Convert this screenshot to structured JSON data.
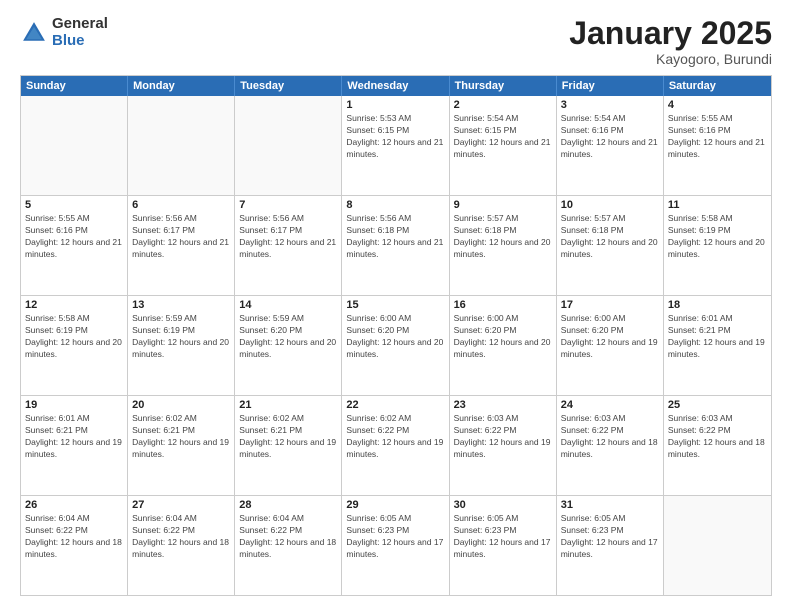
{
  "logo": {
    "general": "General",
    "blue": "Blue"
  },
  "header": {
    "month": "January 2025",
    "location": "Kayogoro, Burundi"
  },
  "weekdays": [
    "Sunday",
    "Monday",
    "Tuesday",
    "Wednesday",
    "Thursday",
    "Friday",
    "Saturday"
  ],
  "rows": [
    [
      {
        "day": "",
        "empty": true
      },
      {
        "day": "",
        "empty": true
      },
      {
        "day": "",
        "empty": true
      },
      {
        "day": "1",
        "sunrise": "5:53 AM",
        "sunset": "6:15 PM",
        "daylight": "12 hours and 21 minutes."
      },
      {
        "day": "2",
        "sunrise": "5:54 AM",
        "sunset": "6:15 PM",
        "daylight": "12 hours and 21 minutes."
      },
      {
        "day": "3",
        "sunrise": "5:54 AM",
        "sunset": "6:16 PM",
        "daylight": "12 hours and 21 minutes."
      },
      {
        "day": "4",
        "sunrise": "5:55 AM",
        "sunset": "6:16 PM",
        "daylight": "12 hours and 21 minutes."
      }
    ],
    [
      {
        "day": "5",
        "sunrise": "5:55 AM",
        "sunset": "6:16 PM",
        "daylight": "12 hours and 21 minutes."
      },
      {
        "day": "6",
        "sunrise": "5:56 AM",
        "sunset": "6:17 PM",
        "daylight": "12 hours and 21 minutes."
      },
      {
        "day": "7",
        "sunrise": "5:56 AM",
        "sunset": "6:17 PM",
        "daylight": "12 hours and 21 minutes."
      },
      {
        "day": "8",
        "sunrise": "5:56 AM",
        "sunset": "6:18 PM",
        "daylight": "12 hours and 21 minutes."
      },
      {
        "day": "9",
        "sunrise": "5:57 AM",
        "sunset": "6:18 PM",
        "daylight": "12 hours and 20 minutes."
      },
      {
        "day": "10",
        "sunrise": "5:57 AM",
        "sunset": "6:18 PM",
        "daylight": "12 hours and 20 minutes."
      },
      {
        "day": "11",
        "sunrise": "5:58 AM",
        "sunset": "6:19 PM",
        "daylight": "12 hours and 20 minutes."
      }
    ],
    [
      {
        "day": "12",
        "sunrise": "5:58 AM",
        "sunset": "6:19 PM",
        "daylight": "12 hours and 20 minutes."
      },
      {
        "day": "13",
        "sunrise": "5:59 AM",
        "sunset": "6:19 PM",
        "daylight": "12 hours and 20 minutes."
      },
      {
        "day": "14",
        "sunrise": "5:59 AM",
        "sunset": "6:20 PM",
        "daylight": "12 hours and 20 minutes."
      },
      {
        "day": "15",
        "sunrise": "6:00 AM",
        "sunset": "6:20 PM",
        "daylight": "12 hours and 20 minutes."
      },
      {
        "day": "16",
        "sunrise": "6:00 AM",
        "sunset": "6:20 PM",
        "daylight": "12 hours and 20 minutes."
      },
      {
        "day": "17",
        "sunrise": "6:00 AM",
        "sunset": "6:20 PM",
        "daylight": "12 hours and 19 minutes."
      },
      {
        "day": "18",
        "sunrise": "6:01 AM",
        "sunset": "6:21 PM",
        "daylight": "12 hours and 19 minutes."
      }
    ],
    [
      {
        "day": "19",
        "sunrise": "6:01 AM",
        "sunset": "6:21 PM",
        "daylight": "12 hours and 19 minutes."
      },
      {
        "day": "20",
        "sunrise": "6:02 AM",
        "sunset": "6:21 PM",
        "daylight": "12 hours and 19 minutes."
      },
      {
        "day": "21",
        "sunrise": "6:02 AM",
        "sunset": "6:21 PM",
        "daylight": "12 hours and 19 minutes."
      },
      {
        "day": "22",
        "sunrise": "6:02 AM",
        "sunset": "6:22 PM",
        "daylight": "12 hours and 19 minutes."
      },
      {
        "day": "23",
        "sunrise": "6:03 AM",
        "sunset": "6:22 PM",
        "daylight": "12 hours and 19 minutes."
      },
      {
        "day": "24",
        "sunrise": "6:03 AM",
        "sunset": "6:22 PM",
        "daylight": "12 hours and 18 minutes."
      },
      {
        "day": "25",
        "sunrise": "6:03 AM",
        "sunset": "6:22 PM",
        "daylight": "12 hours and 18 minutes."
      }
    ],
    [
      {
        "day": "26",
        "sunrise": "6:04 AM",
        "sunset": "6:22 PM",
        "daylight": "12 hours and 18 minutes."
      },
      {
        "day": "27",
        "sunrise": "6:04 AM",
        "sunset": "6:22 PM",
        "daylight": "12 hours and 18 minutes."
      },
      {
        "day": "28",
        "sunrise": "6:04 AM",
        "sunset": "6:22 PM",
        "daylight": "12 hours and 18 minutes."
      },
      {
        "day": "29",
        "sunrise": "6:05 AM",
        "sunset": "6:23 PM",
        "daylight": "12 hours and 17 minutes."
      },
      {
        "day": "30",
        "sunrise": "6:05 AM",
        "sunset": "6:23 PM",
        "daylight": "12 hours and 17 minutes."
      },
      {
        "day": "31",
        "sunrise": "6:05 AM",
        "sunset": "6:23 PM",
        "daylight": "12 hours and 17 minutes."
      },
      {
        "day": "",
        "empty": true
      }
    ]
  ]
}
